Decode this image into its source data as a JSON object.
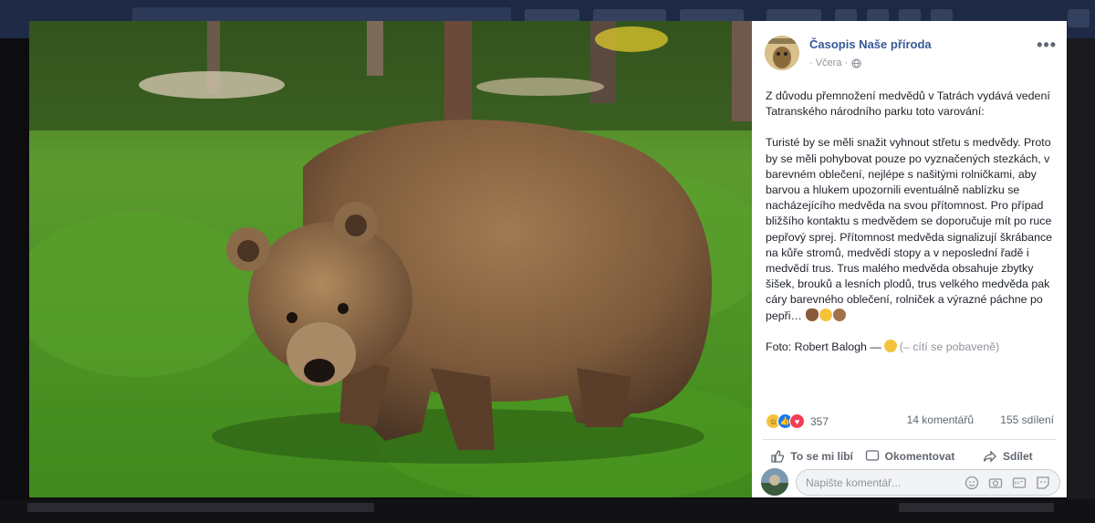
{
  "post": {
    "page_name": "Časopis Naše příroda",
    "time": "· Včera ·",
    "paragraph_1": "Z důvodu přemnožení medvědů v Tatrách vydává vedení Tatranského národního parku toto varování:",
    "paragraph_2": "Turisté by se měli snažit vyhnout střetu s medvědy. Proto by se měli pohybovat pouze po vyznačených stezkách, v barevném oblečení, nejlépe s našitými rolničkami, aby barvou a hlukem upozornili eventuálně nablízku se nacházejícího medvěda na svou přítomnost. Pro případ bližšího kontaktu s medvědem se doporučuje mít po ruce pepřový sprej. Přítomnost medvěda signalizují škrábance na kůře stromů, medvědí stopy a v neposlední řadě i medvědí trus. Trus malého medvěda obsahuje zbytky šišek, brouků a lesních plodů, trus velkého medvěda pak cáry barevného oblečení, rolniček a výrazné páchne po pepři…",
    "photo_credit": "Foto: Robert Balogh —",
    "feeling": "(– cítí se pobaveně)"
  },
  "stats": {
    "reaction_count": "357",
    "comments": "14 komentářů",
    "shares": "155 sdílení"
  },
  "actions": {
    "like": "To se mi líbí",
    "comment": "Okomentovat",
    "share": "Sdílet"
  },
  "comment_input": {
    "placeholder": "Napište komentář..."
  },
  "icons": [
    "more-icon",
    "globe-icon",
    "like-icon",
    "comment-icon",
    "share-icon",
    "emoji-icon",
    "camera-icon",
    "gif-icon",
    "sticker-icon"
  ],
  "colors": {
    "link": "#365899",
    "like_blue": "#1877f2",
    "love_red": "#f33e58",
    "haha_yellow": "#f5c33b"
  }
}
